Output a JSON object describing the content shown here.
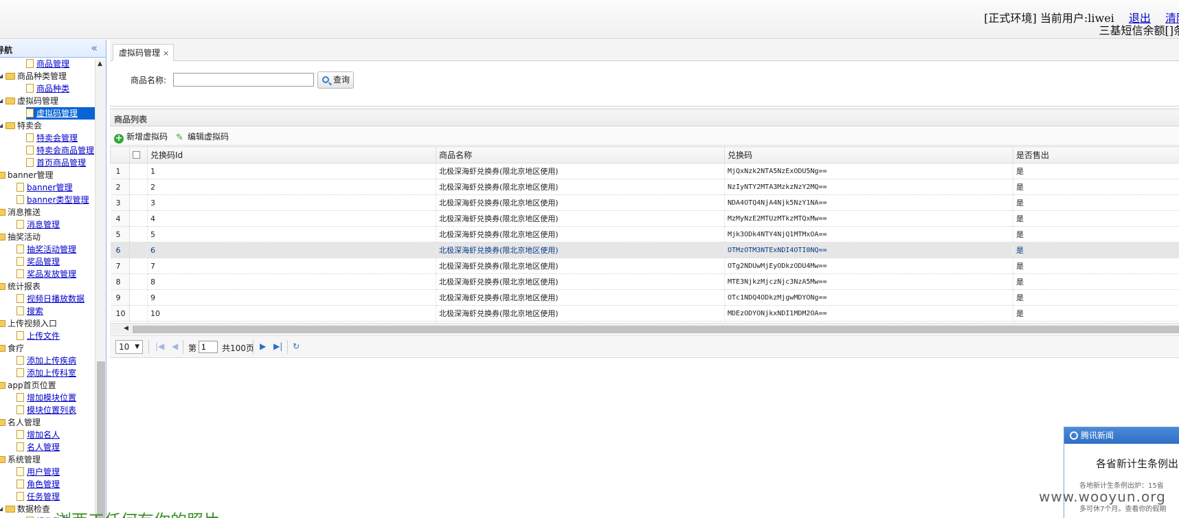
{
  "header": {
    "env_text": "[正式环境] 当前用户:liwei",
    "logout": "退出",
    "clear": "清除",
    "sms_text": "三基短信余额[]条"
  },
  "sidebar": {
    "title": "导航",
    "collapse_icon": "«",
    "tree": [
      {
        "label": "商品管理",
        "type": "leaf",
        "indent": 1
      },
      {
        "label": "商品种类管理",
        "type": "folder",
        "indent": 0
      },
      {
        "label": "商品种类",
        "type": "leaf",
        "indent": 1
      },
      {
        "label": "虚拟码管理",
        "type": "folder",
        "indent": 0
      },
      {
        "label": "虚拟码管理",
        "type": "leaf",
        "indent": 1,
        "selected": true
      },
      {
        "label": "特卖会",
        "type": "folder",
        "indent": 0
      },
      {
        "label": "特卖会管理",
        "type": "leaf",
        "indent": 1
      },
      {
        "label": "特卖会商品管理",
        "type": "leaf",
        "indent": 1
      },
      {
        "label": "首页商品管理",
        "type": "leaf",
        "indent": 1
      },
      {
        "label": "banner管理",
        "type": "folder",
        "indent": -1
      },
      {
        "label": "banner管理",
        "type": "leaf",
        "indent": 0
      },
      {
        "label": "banner类型管理",
        "type": "leaf",
        "indent": 0
      },
      {
        "label": "消息推送",
        "type": "folder",
        "indent": -1
      },
      {
        "label": "消息管理",
        "type": "leaf",
        "indent": 0
      },
      {
        "label": "抽奖活动",
        "type": "folder",
        "indent": -1
      },
      {
        "label": "抽奖活动管理",
        "type": "leaf",
        "indent": 0
      },
      {
        "label": "奖品管理",
        "type": "leaf",
        "indent": 0
      },
      {
        "label": "奖品发放管理",
        "type": "leaf",
        "indent": 0
      },
      {
        "label": "统计报表",
        "type": "folder",
        "indent": -1
      },
      {
        "label": "视频日播放数据",
        "type": "leaf",
        "indent": 0
      },
      {
        "label": "搜索",
        "type": "leaf",
        "indent": 0
      },
      {
        "label": "上传视频入口",
        "type": "folder",
        "indent": -1
      },
      {
        "label": "上传文件",
        "type": "leaf",
        "indent": 0
      },
      {
        "label": "食疗",
        "type": "folder",
        "indent": -1
      },
      {
        "label": "添加上传疾病",
        "type": "leaf",
        "indent": 0
      },
      {
        "label": "添加上传科室",
        "type": "leaf",
        "indent": 0
      },
      {
        "label": "app首页位置",
        "type": "folder",
        "indent": -1
      },
      {
        "label": "增加模块位置",
        "type": "leaf",
        "indent": 0
      },
      {
        "label": "模块位置列表",
        "type": "leaf",
        "indent": 0
      },
      {
        "label": "名人管理",
        "type": "folder",
        "indent": -1
      },
      {
        "label": "增加名人",
        "type": "leaf",
        "indent": 0
      },
      {
        "label": "名人管理",
        "type": "leaf",
        "indent": 0
      },
      {
        "label": "系统管理",
        "type": "folder",
        "indent": -1
      },
      {
        "label": "用户管理",
        "type": "leaf",
        "indent": 0
      },
      {
        "label": "角色管理",
        "type": "leaf",
        "indent": 0
      },
      {
        "label": "任务管理",
        "type": "leaf",
        "indent": 0
      },
      {
        "label": "数据检查",
        "type": "folder",
        "indent": 0
      },
      {
        "label": "操作数据",
        "type": "leaf",
        "indent": 1
      }
    ]
  },
  "tab": {
    "label": "虚拟码管理",
    "close": "×"
  },
  "search": {
    "label": "商品名称:",
    "value": "",
    "button": "查询"
  },
  "grid": {
    "title": "商品列表",
    "add_button": "新增虚拟码",
    "edit_button": "编辑虚拟码",
    "columns": [
      "兑换码Id",
      "商品名称",
      "兑换码",
      "是否售出"
    ],
    "rows": [
      {
        "num": "1",
        "id": "1",
        "name": "北极深海虾兑换券(限北京地区使用)",
        "code": "MjQxNzk2NTA5NzExODU5Ng==",
        "sold": "是"
      },
      {
        "num": "2",
        "id": "2",
        "name": "北极深海虾兑换券(限北京地区使用)",
        "code": "NzIyNTY2MTA3MzkzNzY2MQ==",
        "sold": "是"
      },
      {
        "num": "3",
        "id": "3",
        "name": "北极深海虾兑换券(限北京地区使用)",
        "code": "NDA4OTQ4NjA4Njk5NzY1NA==",
        "sold": "是"
      },
      {
        "num": "4",
        "id": "4",
        "name": "北极深海虾兑换券(限北京地区使用)",
        "code": "MzMyNzE2MTUzMTkzMTQxMw==",
        "sold": "是"
      },
      {
        "num": "5",
        "id": "5",
        "name": "北极深海虾兑换券(限北京地区使用)",
        "code": "Mjk3ODk4NTY4NjQ1MTMxOA==",
        "sold": "是"
      },
      {
        "num": "6",
        "id": "6",
        "name": "北极深海虾兑换券(限北京地区使用)",
        "code": "OTMzOTM3NTExNDI4OTI0NQ==",
        "sold": "是",
        "hover": true
      },
      {
        "num": "7",
        "id": "7",
        "name": "北极深海虾兑换券(限北京地区使用)",
        "code": "OTg2NDUwMjEyODkzODU4Mw==",
        "sold": "是"
      },
      {
        "num": "8",
        "id": "8",
        "name": "北极深海虾兑换券(限北京地区使用)",
        "code": "MTE3NjkzMjczNjc3NzA5Mw==",
        "sold": "是"
      },
      {
        "num": "9",
        "id": "9",
        "name": "北极深海虾兑换券(限北京地区使用)",
        "code": "OTc1NDQ4ODkzMjgwMDYONg==",
        "sold": "是"
      },
      {
        "num": "10",
        "id": "10",
        "name": "北极深海虾兑换券(限北京地区使用)",
        "code": "MDEzODYONjkxNDI1MDM2OA==",
        "sold": "是"
      }
    ]
  },
  "pager": {
    "page_size": "10",
    "page_prefix": "第",
    "page_value": "1",
    "page_total": "共100页"
  },
  "news": {
    "brand": "腾讯新闻",
    "headline": "各省新计生条例出",
    "snippet1": "各地新计生条例出炉：15省",
    "snippet2": "多可休7个月。查看你的假期"
  },
  "watermark": "www.wooyun.org",
  "overlay_text": "浏西工任何有你的照片"
}
